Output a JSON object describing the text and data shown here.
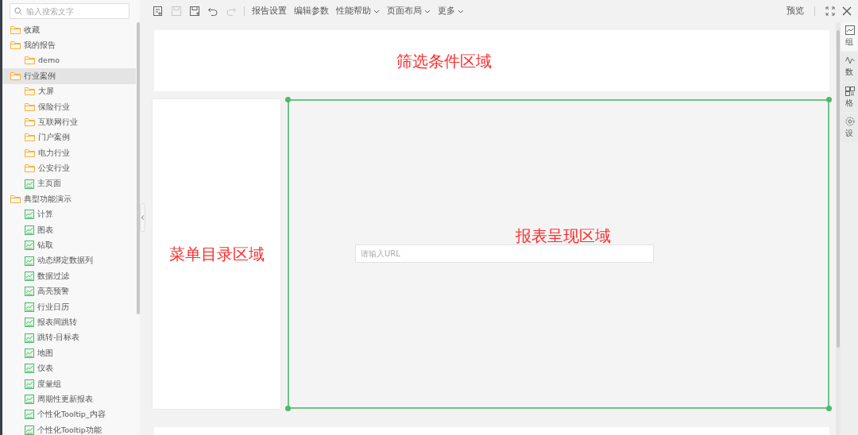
{
  "search": {
    "placeholder": "输入搜索文字"
  },
  "tree": [
    {
      "label": "收藏",
      "kind": "folder",
      "selected": false
    },
    {
      "label": "我的报告",
      "kind": "folder",
      "selected": false,
      "children": [
        {
          "label": "demo",
          "kind": "folder",
          "selected": false
        }
      ]
    },
    {
      "label": "行业案例",
      "kind": "folder",
      "selected": true,
      "children": [
        {
          "label": "大屏",
          "kind": "folder",
          "selected": false
        },
        {
          "label": "保险行业",
          "kind": "folder",
          "selected": false
        },
        {
          "label": "互联网行业",
          "kind": "folder",
          "selected": false
        },
        {
          "label": "门户案例",
          "kind": "folder",
          "selected": false
        },
        {
          "label": "电力行业",
          "kind": "folder",
          "selected": false
        },
        {
          "label": "公安行业",
          "kind": "folder",
          "selected": false
        },
        {
          "label": "主页面",
          "kind": "report",
          "selected": false
        }
      ]
    },
    {
      "label": "典型功能演示",
      "kind": "folder",
      "selected": false,
      "children": [
        {
          "label": "计算",
          "kind": "report",
          "selected": false
        },
        {
          "label": "图表",
          "kind": "report",
          "selected": false
        },
        {
          "label": "钻取",
          "kind": "report",
          "selected": false
        },
        {
          "label": "动态绑定数据列",
          "kind": "report",
          "selected": false
        },
        {
          "label": "数据过滤",
          "kind": "report",
          "selected": false
        },
        {
          "label": "高亮预警",
          "kind": "report",
          "selected": false
        },
        {
          "label": "行业日历",
          "kind": "report",
          "selected": false
        },
        {
          "label": "报表间跳转",
          "kind": "report",
          "selected": false
        },
        {
          "label": "跳转-目标表",
          "kind": "report",
          "selected": false
        },
        {
          "label": "地图",
          "kind": "report",
          "selected": false
        },
        {
          "label": "仪表",
          "kind": "report",
          "selected": false
        },
        {
          "label": "度量组",
          "kind": "report",
          "selected": false
        },
        {
          "label": "周期性更新报表",
          "kind": "report",
          "selected": false
        },
        {
          "label": "个性化Tooltip_内容",
          "kind": "report",
          "selected": false
        },
        {
          "label": "个性化Tooltip功能",
          "kind": "report",
          "selected": false
        }
      ]
    }
  ],
  "toolbar": {
    "icons": [
      {
        "kind": "new",
        "disabled": false
      },
      {
        "kind": "save",
        "disabled": true
      },
      {
        "kind": "save-as",
        "disabled": false
      },
      {
        "kind": "undo",
        "disabled": false
      },
      {
        "kind": "redo",
        "disabled": true
      }
    ],
    "menus": [
      {
        "label": "报告设置",
        "dropdown": false
      },
      {
        "label": "编辑参数",
        "dropdown": false
      },
      {
        "label": "性能帮助",
        "dropdown": true
      },
      {
        "label": "页面布局",
        "dropdown": true
      },
      {
        "label": "更多",
        "dropdown": true
      }
    ],
    "preview": "预览"
  },
  "canvas": {
    "filter_label": "筛选条件区域",
    "menu_label": "菜单目录区域",
    "report_label": "报表呈现区域",
    "url_field": {
      "placeholder": "请输入URL"
    }
  },
  "right_panel": [
    {
      "label": "组",
      "kind": "component",
      "selected": true
    },
    {
      "label": "数",
      "kind": "data",
      "selected": false
    },
    {
      "label": "格",
      "kind": "format",
      "selected": false
    },
    {
      "label": "设",
      "kind": "settings",
      "selected": false
    }
  ]
}
